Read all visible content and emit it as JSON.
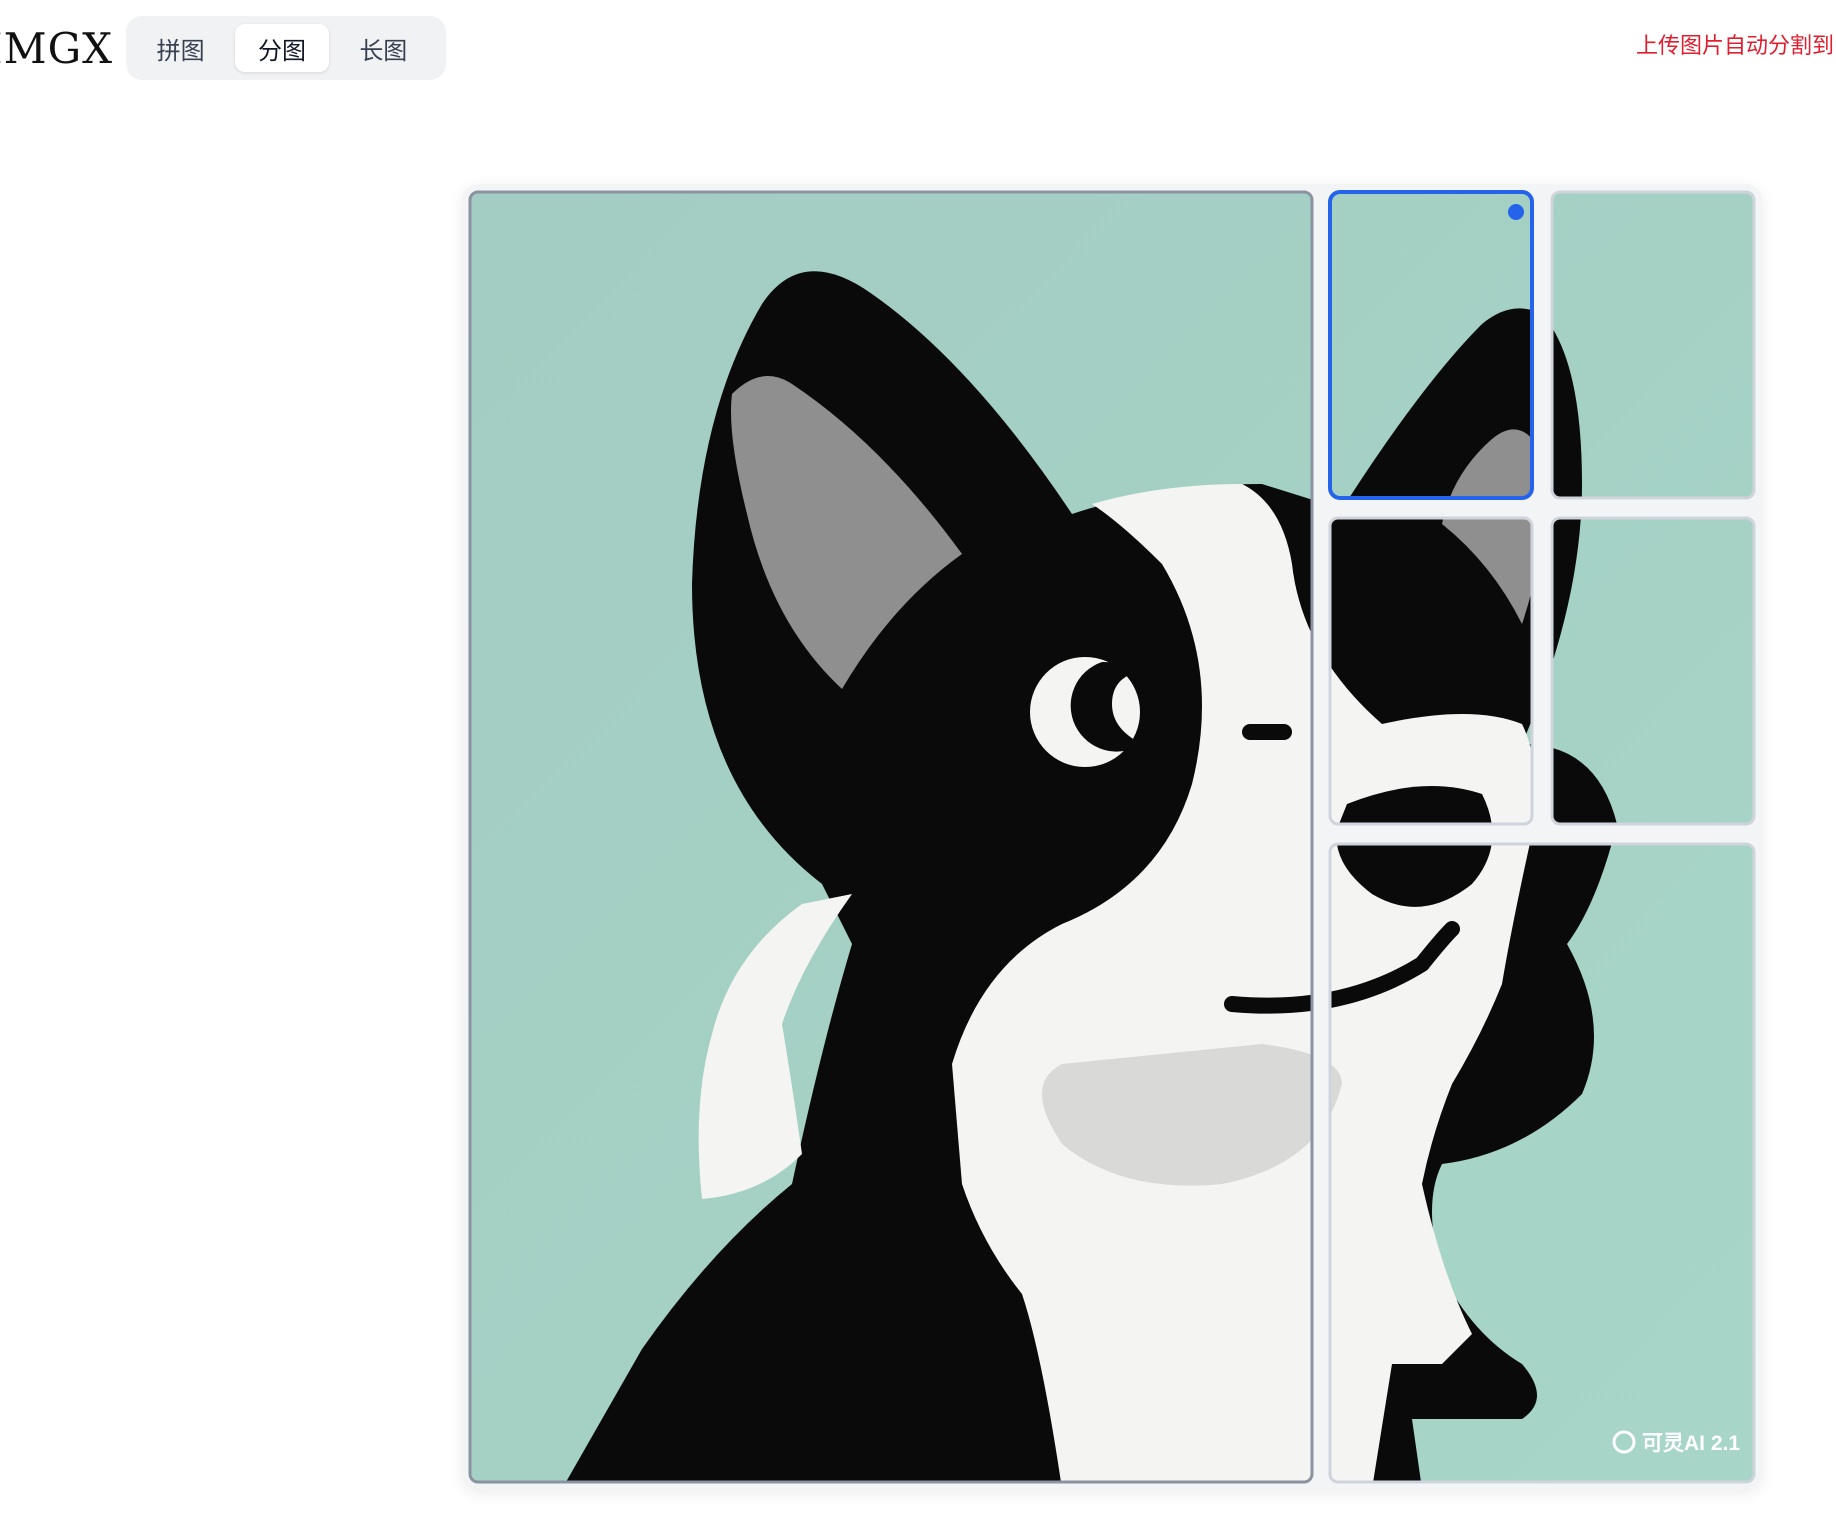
{
  "header": {
    "logo": "IMGX",
    "tabs": [
      {
        "label": "拼图",
        "active": false
      },
      {
        "label": "分图",
        "active": true
      },
      {
        "label": "长图",
        "active": false
      }
    ],
    "hint": "上传图片自动分割到"
  },
  "canvas": {
    "watermark": "可灵AI 2.1",
    "selected_cell": 1
  },
  "colors": {
    "accent": "#2563eb",
    "hint_text": "#e11d2e",
    "image_bg": "#a3ccc2"
  }
}
